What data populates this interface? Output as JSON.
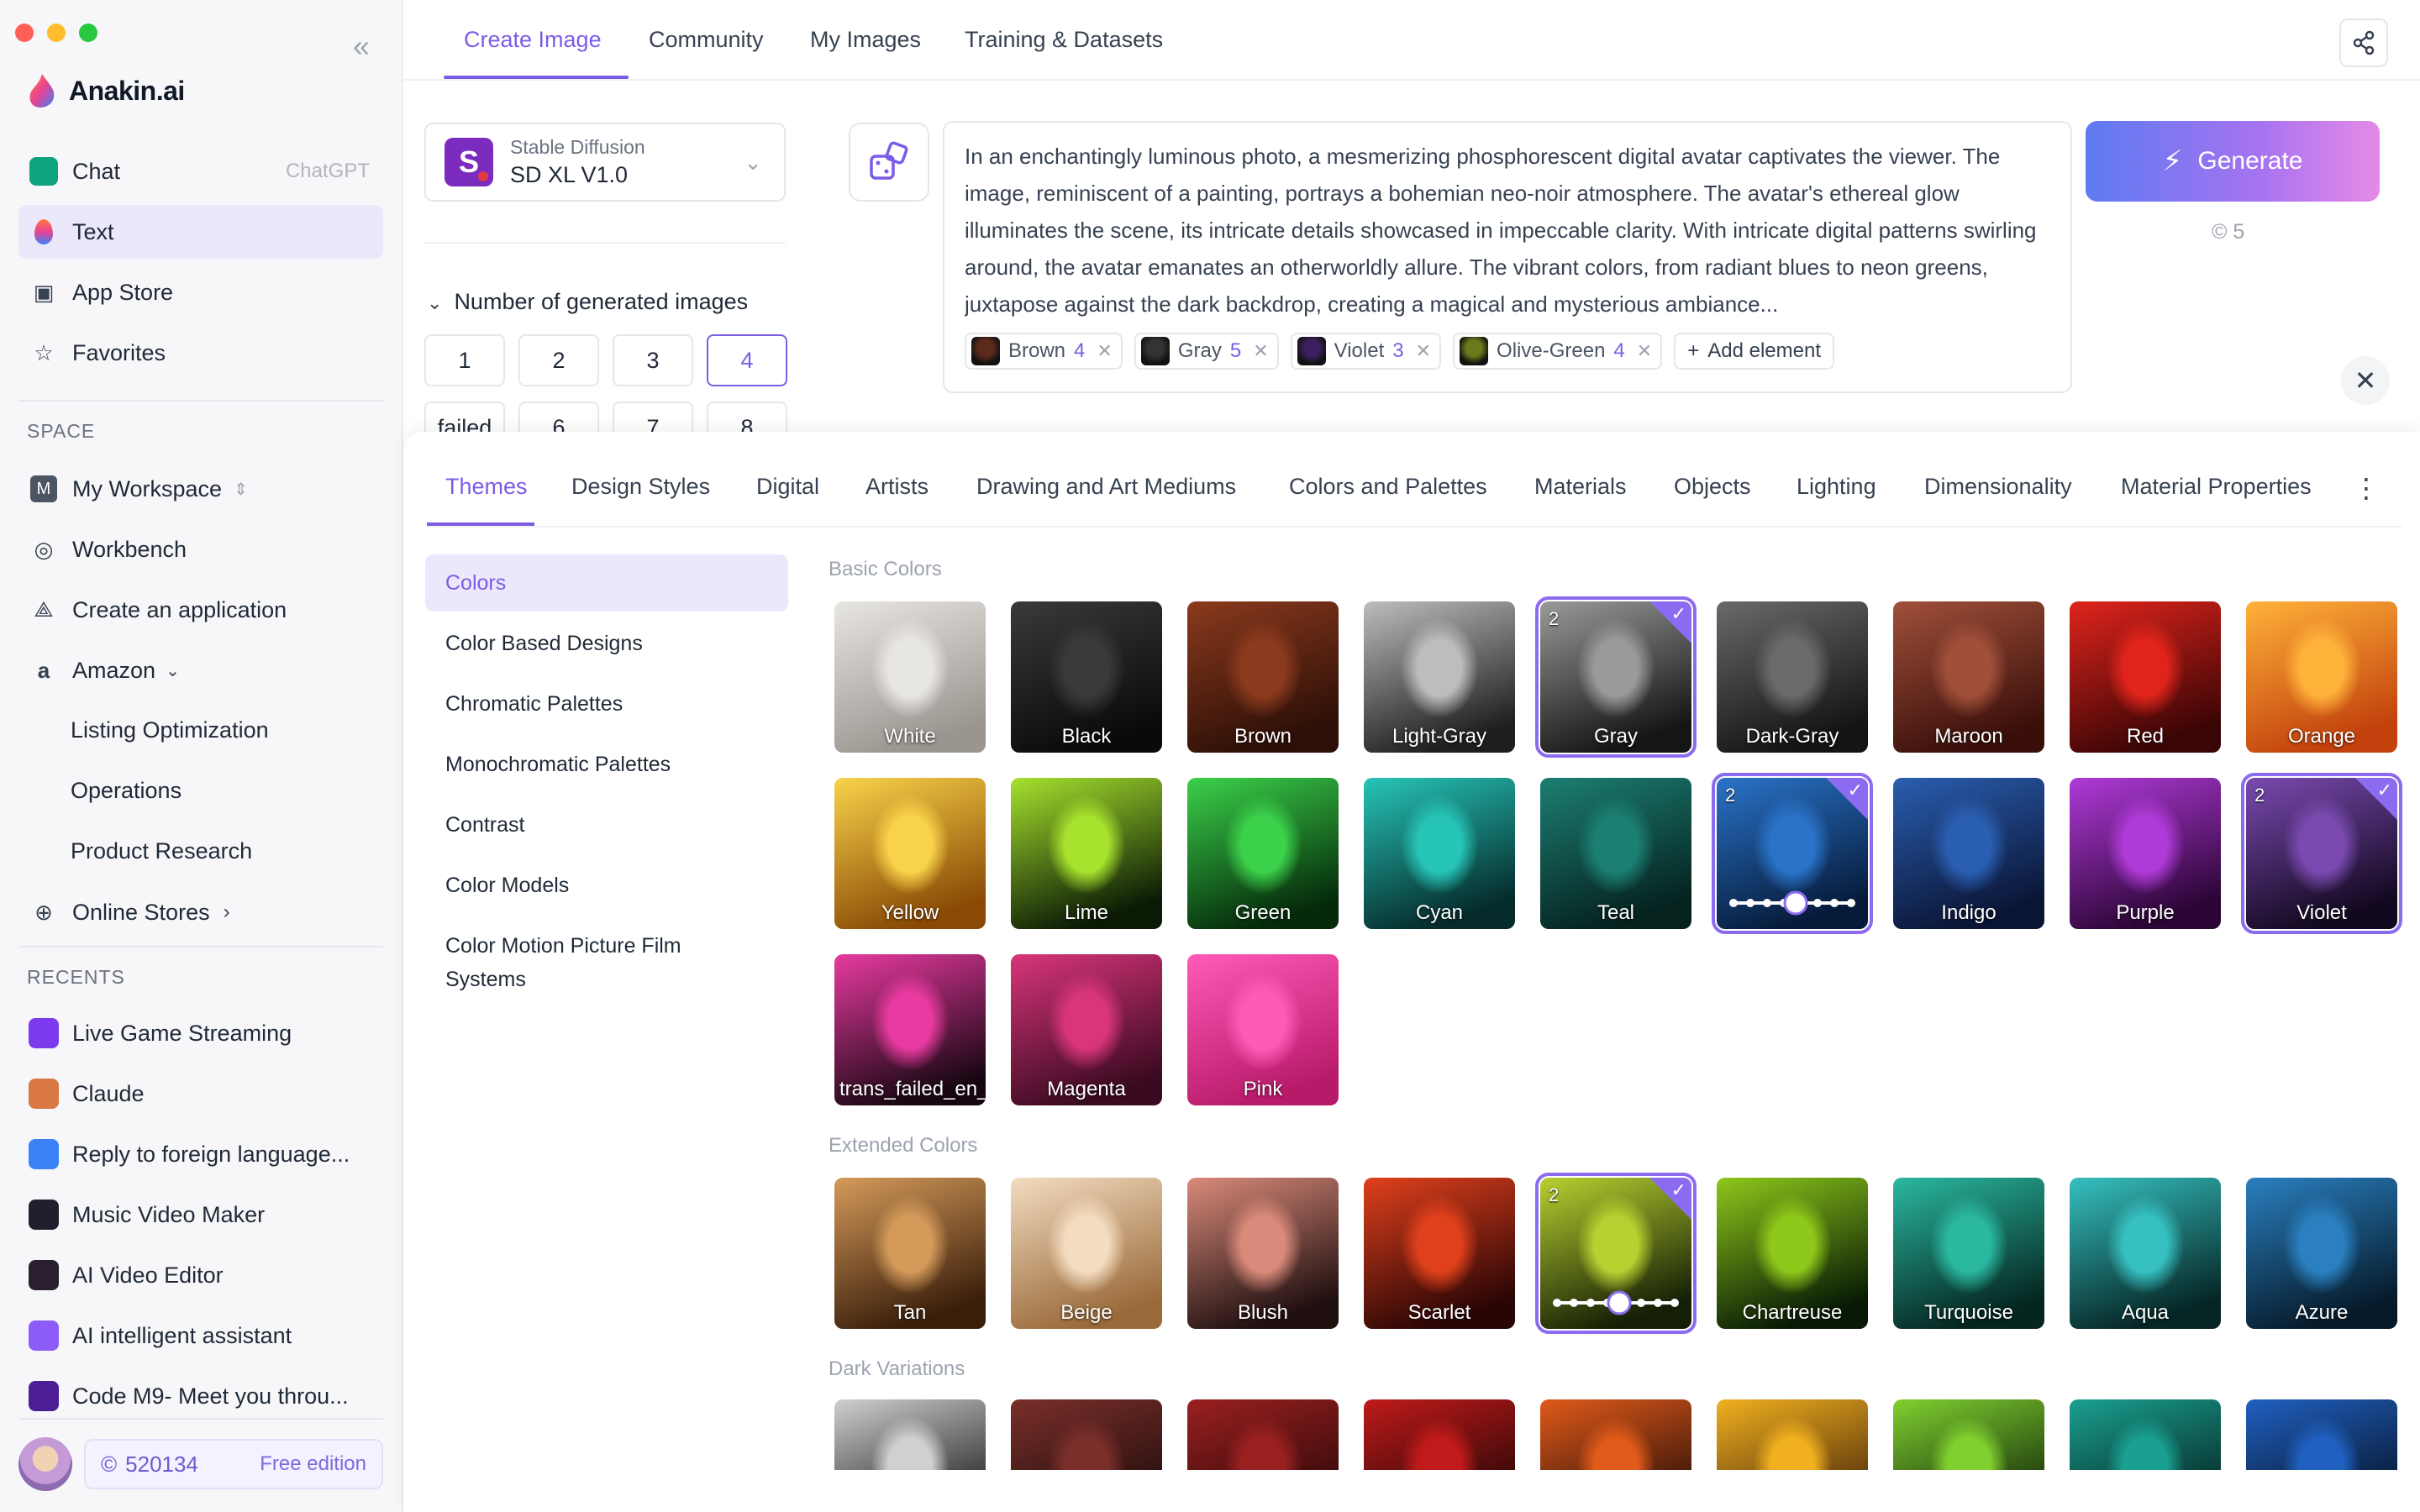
{
  "sidebar": {
    "brand": "Anakin.ai",
    "nav": [
      {
        "label": "Chat",
        "hint": "ChatGPT"
      },
      {
        "label": "Text"
      },
      {
        "label": "App Store"
      },
      {
        "label": "Favorites"
      }
    ],
    "space_label": "SPACE",
    "space": [
      {
        "label": "My Workspace"
      },
      {
        "label": "Workbench"
      },
      {
        "label": "Create an application"
      },
      {
        "label": "Amazon"
      }
    ],
    "amazon_children": [
      "Listing Optimization",
      "Operations",
      "Product Research"
    ],
    "online_stores": "Online Stores",
    "recents_label": "RECENTS",
    "recents": [
      {
        "label": "Live Game Streaming",
        "color": "#7c3aed"
      },
      {
        "label": "Claude",
        "color": "#d97745"
      },
      {
        "label": "Reply to foreign language...",
        "color": "#3b82f6"
      },
      {
        "label": "Music Video Maker",
        "color": "#1f1f2e"
      },
      {
        "label": "AI Video Editor",
        "color": "#2a1f2f"
      },
      {
        "label": "AI intelligent assistant",
        "color": "#8b5cf6"
      },
      {
        "label": "Code M9- Meet you throu...",
        "color": "#4c1d95"
      }
    ],
    "credits": "520134",
    "plan": "Free edition"
  },
  "top_tabs": [
    "Create Image",
    "Community",
    "My Images",
    "Training & Datasets"
  ],
  "model": {
    "provider": "Stable Diffusion",
    "name": "SD XL V1.0"
  },
  "num_images": {
    "label": "Number of generated images",
    "options": [
      "1",
      "2",
      "3",
      "4"
    ],
    "selected": "4",
    "row2": [
      "failed",
      "6",
      "7",
      "8"
    ]
  },
  "prompt": {
    "text": "In an enchantingly luminous photo, a mesmerizing phosphorescent digital avatar captivates the viewer. The image, reminiscent of a painting, portrays a bohemian neo-noir atmosphere. The avatar's ethereal glow illuminates the scene, its intricate details showcased in impeccable clarity. With intricate digital patterns swirling around, the avatar emanates an otherworldly allure. The vibrant colors, from radiant blues to neon greens, juxtapose against the dark backdrop, creating a magical and mysterious ambiance...",
    "chips": [
      {
        "label": "Brown",
        "count": "4",
        "color": "#5a2a1a"
      },
      {
        "label": "Gray",
        "count": "5",
        "color": "#333333"
      },
      {
        "label": "Violet",
        "count": "3",
        "color": "#3b1f5e"
      },
      {
        "label": "Olive-Green",
        "count": "4",
        "color": "#6b7a1a"
      }
    ],
    "add_element": "Add element"
  },
  "generate": {
    "label": "Generate",
    "cost": "5"
  },
  "category_tabs": [
    "Themes",
    "Design Styles",
    "Digital",
    "Artists",
    "Drawing and Art Mediums",
    "Colors and Palettes",
    "Materials",
    "Objects",
    "Lighting",
    "Dimensionality",
    "Material Properties"
  ],
  "sub_categories": [
    "Colors",
    "Color Based Designs",
    "Chromatic Palettes",
    "Monochromatic Palettes",
    "Contrast",
    "Color Models",
    "Color Motion Picture Film Systems"
  ],
  "groups": {
    "basic": {
      "title": "Basic Colors",
      "tiles": [
        {
          "label": "White",
          "c1": "#e8e6e3",
          "c2": "#9a958f"
        },
        {
          "label": "Black",
          "c1": "#3a3a3a",
          "c2": "#0a0a0a"
        },
        {
          "label": "Brown",
          "c1": "#8b3a1e",
          "c2": "#2c0f06"
        },
        {
          "label": "Light-Gray",
          "c1": "#bdbdbd",
          "c2": "#1f1f1f"
        },
        {
          "label": "Gray",
          "c1": "#9a9a9a",
          "c2": "#151515",
          "selected": true,
          "count": "2"
        },
        {
          "label": "Dark-Gray",
          "c1": "#6a6a6a",
          "c2": "#141414"
        },
        {
          "label": "Maroon",
          "c1": "#a0503a",
          "c2": "#3a0f0a"
        },
        {
          "label": "Red",
          "c1": "#e0241c",
          "c2": "#3a0505"
        },
        {
          "label": "Orange",
          "c1": "#ffb23a",
          "c2": "#c2410c"
        },
        {
          "label": "Yellow",
          "c1": "#f8d34a",
          "c2": "#8a4a05"
        },
        {
          "label": "Lime",
          "c1": "#a6e22e",
          "c2": "#0b1a05"
        },
        {
          "label": "Green",
          "c1": "#3bd14a",
          "c2": "#052a0a"
        },
        {
          "label": "Cyan",
          "c1": "#27c5b8",
          "c2": "#052b2b"
        },
        {
          "label": "Teal",
          "c1": "#1c7f73",
          "c2": "#05221f"
        },
        {
          "label": "",
          "c1": "#2a73c9",
          "c2": "#061b3a",
          "selected": true,
          "count": "2",
          "slider": true
        },
        {
          "label": "Indigo",
          "c1": "#2a5eb0",
          "c2": "#0a1535"
        },
        {
          "label": "Purple",
          "c1": "#b03ad8",
          "c2": "#2b0535"
        },
        {
          "label": "Violet",
          "c1": "#7a4ab0",
          "c2": "#12081f",
          "selected": true,
          "count": "2"
        },
        {
          "label": "trans_failed_en_Fuchsia",
          "c1": "#e83aa0",
          "c2": "#180712"
        },
        {
          "label": "Magenta",
          "c1": "#d8357a",
          "c2": "#3a0a20"
        },
        {
          "label": "Pink",
          "c1": "#ff5ab8",
          "c2": "#b81a6a"
        }
      ]
    },
    "extended": {
      "title": "Extended Colors",
      "tiles": [
        {
          "label": "Tan",
          "c1": "#d49a5a",
          "c2": "#3a1e0a"
        },
        {
          "label": "Beige",
          "c1": "#f3dcc0",
          "c2": "#9a6a3a"
        },
        {
          "label": "Blush",
          "c1": "#d98a7a",
          "c2": "#1f0f0f"
        },
        {
          "label": "Scarlet",
          "c1": "#e0401c",
          "c2": "#2a0505"
        },
        {
          "label": "",
          "c1": "#b8d030",
          "c2": "#151f05",
          "selected": true,
          "count": "2",
          "slider": true
        },
        {
          "label": "Chartreuse",
          "c1": "#8dc81a",
          "c2": "#081a05"
        },
        {
          "label": "Turquoise",
          "c1": "#2ab8a0",
          "c2": "#052520"
        },
        {
          "label": "Aqua",
          "c1": "#36c0c0",
          "c2": "#062525"
        },
        {
          "label": "Azure",
          "c1": "#2a80c0",
          "c2": "#061a2a"
        }
      ]
    },
    "dark": {
      "title": "Dark Variations",
      "tiles": [
        {
          "label": "",
          "c1": "#d0d0d0",
          "c2": "#0a0a0a"
        },
        {
          "label": "",
          "c1": "#7a2f2a",
          "c2": "#150808"
        },
        {
          "label": "",
          "c1": "#9a2020",
          "c2": "#200505"
        },
        {
          "label": "",
          "c1": "#c01a1a",
          "c2": "#100303"
        },
        {
          "label": "",
          "c1": "#e05a1a",
          "c2": "#150505"
        },
        {
          "label": "",
          "c1": "#f0b020",
          "c2": "#3a1a05"
        },
        {
          "label": "",
          "c1": "#80d030",
          "c2": "#051505"
        },
        {
          "label": "",
          "c1": "#1aa090",
          "c2": "#031515"
        },
        {
          "label": "",
          "c1": "#2060c0",
          "c2": "#030a15"
        }
      ]
    }
  },
  "colors": {
    "accent": "#7c5ce6",
    "accent_soft": "#ebe8fb"
  }
}
